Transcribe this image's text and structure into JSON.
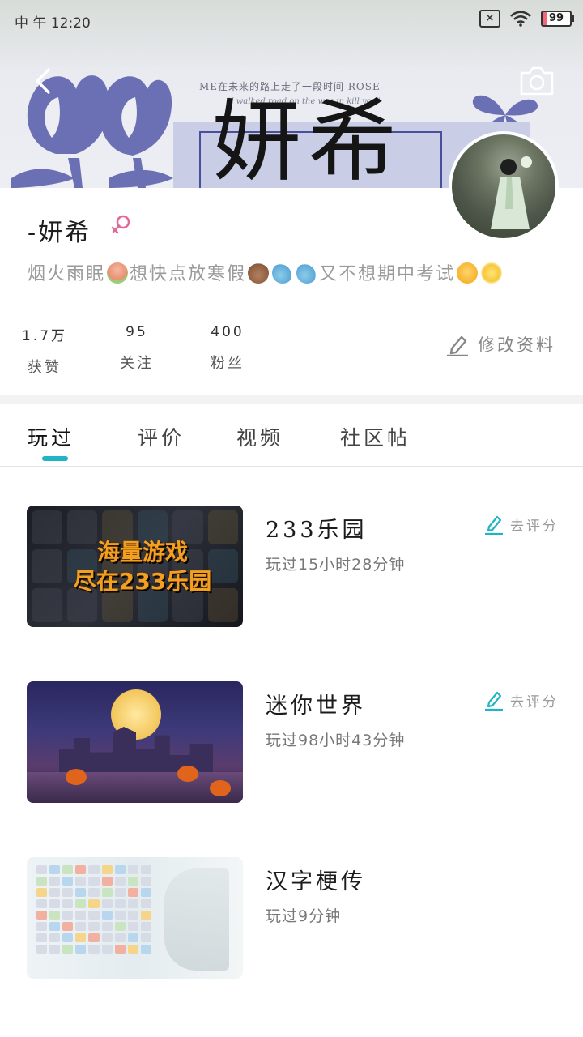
{
  "status_bar": {
    "time": "中 午 12:20",
    "battery": "99"
  },
  "banner": {
    "tagline": "ME在未来的路上走了一段时间 ROSE",
    "sub_tagline": "\"I walked road on the was in kill you\"",
    "rose_word": "ROSE",
    "calligraphy": "妍希"
  },
  "profile": {
    "nickname": "-妍希",
    "bio_part1": "烟火雨眠",
    "bio_part2": "想快点放寒假",
    "bio_part3": "又不想期中考试",
    "stats": [
      {
        "value": "1.7万",
        "label": "获赞"
      },
      {
        "value": "95",
        "label": "关注"
      },
      {
        "value": "400",
        "label": "粉丝"
      }
    ],
    "edit_label": "修改资料"
  },
  "tabs": [
    {
      "label": "玩过"
    },
    {
      "label": "评价"
    },
    {
      "label": "视频"
    },
    {
      "label": "社区帖"
    }
  ],
  "games": [
    {
      "title": "233乐园",
      "played": "玩过15小时28分钟",
      "rate_label": "去评分",
      "promo_line1": "海量游戏",
      "promo_line2": "尽在233乐园"
    },
    {
      "title": "迷你世界",
      "played": "玩过98小时43分钟",
      "rate_label": "去评分"
    },
    {
      "title": "汉字梗传",
      "played": "玩过9分钟"
    }
  ],
  "colors": {
    "accent": "#22b4c4",
    "gender": "#e0689a"
  }
}
